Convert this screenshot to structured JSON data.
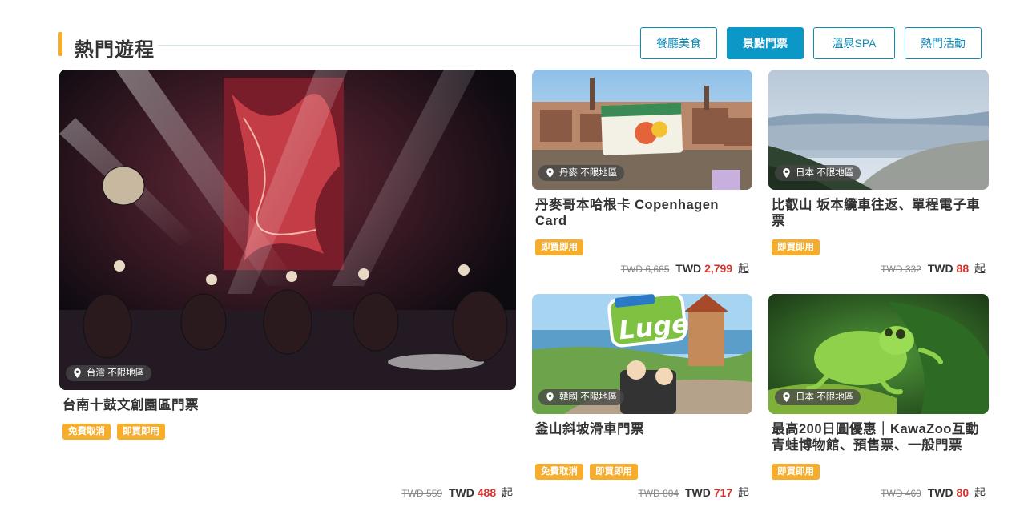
{
  "section": {
    "title": "熱門遊程",
    "tabs": [
      {
        "label": "餐廳美食",
        "active": false
      },
      {
        "label": "景點門票",
        "active": true
      },
      {
        "label": "溫泉SPA",
        "active": false
      },
      {
        "label": "熱門活動",
        "active": false
      }
    ]
  },
  "colors": {
    "accent": "#0b98c6",
    "tag": "#f6ad2b",
    "price": "#d8322d"
  },
  "cards": [
    {
      "location": "台灣 不限地區",
      "title": "台南十鼓文創園區門票",
      "tags": [
        "免費取消",
        "即買即用"
      ],
      "price": {
        "original": "TWD 559",
        "currency": "TWD",
        "amount": "488",
        "suffix": "起"
      },
      "image": "drum-performance-photo"
    },
    {
      "location": "丹麥 不限地區",
      "title": "丹麥哥本哈根卡 Copenhagen Card",
      "tags": [
        "即買即用"
      ],
      "price": {
        "original": "TWD 6,665",
        "currency": "TWD",
        "amount": "2,799",
        "suffix": "起"
      },
      "image": "copenhagen-city-photo"
    },
    {
      "location": "日本 不限地區",
      "title": "比叡山 坂本纜車往返、單程電子車票",
      "tags": [
        "即買即用"
      ],
      "price": {
        "original": "TWD 332",
        "currency": "TWD",
        "amount": "88",
        "suffix": "起"
      },
      "image": "mountain-lake-view-photo"
    },
    {
      "location": "韓國 不限地區",
      "title": "釜山斜坡滑車門票",
      "tags": [
        "免費取消",
        "即買即用"
      ],
      "price": {
        "original": "TWD 804",
        "currency": "TWD",
        "amount": "717",
        "suffix": "起"
      },
      "image": "skyline-luge-photo",
      "logo_text": "Luge"
    },
    {
      "location": "日本 不限地區",
      "title": "最高200日圓優惠｜KawaZoo互動青蛙博物館、預售票、一般門票",
      "tags": [
        "即買即用"
      ],
      "price": {
        "original": "TWD 460",
        "currency": "TWD",
        "amount": "80",
        "suffix": "起"
      },
      "image": "green-frog-photo"
    }
  ]
}
